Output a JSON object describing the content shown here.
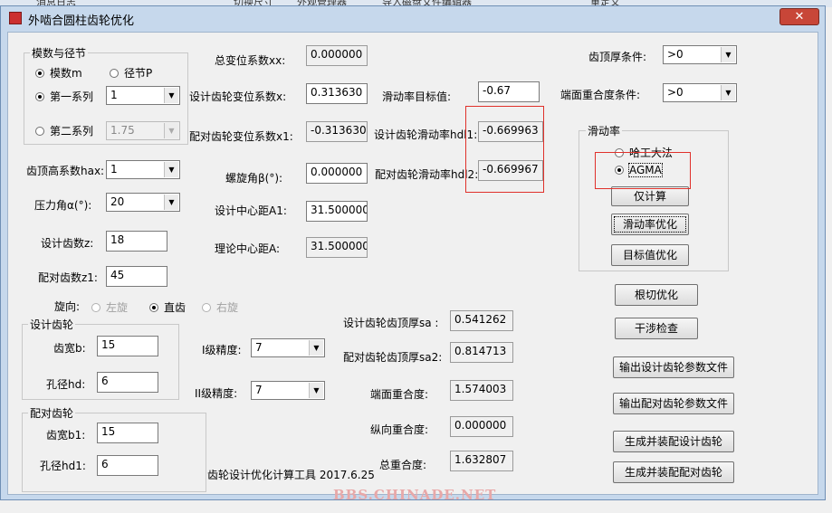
{
  "background_taskbar": [
    "消息日志",
    "切换尺寸",
    "外观管理器",
    "导入磁盘文件编辑器",
    "重定义"
  ],
  "window": {
    "title": "外啮合圆柱齿轮优化",
    "close_glyph": "✕"
  },
  "left_group": {
    "title": "模数与径节",
    "radio_modulus": "模数m",
    "radio_pitch": "径节P",
    "radio_series1": "第一系列",
    "series1_value": "1",
    "radio_series2": "第二系列",
    "series2_value": "1.75"
  },
  "fields": {
    "addendum_coef_label": "齿顶高系数hax:",
    "addendum_coef_value": "1",
    "pressure_angle_label": "压力角α(°):",
    "pressure_angle_value": "20",
    "teeth_z_label": "设计齿数z:",
    "teeth_z_value": "18",
    "teeth_z1_label": "配对齿数z1:",
    "teeth_z1_value": "45",
    "total_shift_label": "总变位系数xx:",
    "total_shift_value": "0.000000",
    "design_shift_label": "设计齿轮变位系数x:",
    "design_shift_value": "0.313630",
    "pair_shift_label": "配对齿轮变位系数x1:",
    "pair_shift_value": "-0.313630",
    "helix_angle_label": "螺旋角β(°):",
    "helix_angle_value": "0.000000",
    "design_center_label": "设计中心距A1:",
    "design_center_value": "31.500000",
    "theory_center_label": "理论中心距A:",
    "theory_center_value": "31.500000",
    "slide_target_label": "滑动率目标值:",
    "slide_target_value": "-0.67",
    "design_slide_label": "设计齿轮滑动率hdl1:",
    "design_slide_value": "-0.669963",
    "pair_slide_label": "配对齿轮滑动率hdl2:",
    "pair_slide_value": "-0.669967",
    "tip_thick_cond_label": "齿顶厚条件:",
    "tip_thick_cond_value": ">0",
    "contact_ratio_cond_label": "端面重合度条件:",
    "contact_ratio_cond_value": ">0"
  },
  "rotation": {
    "label": "旋向:",
    "left": "左旋",
    "straight": "直齿",
    "right": "右旋"
  },
  "design_gear": {
    "title": "设计齿轮",
    "width_label": "齿宽b:",
    "width_value": "15",
    "bore_label": "孔径hd:",
    "bore_value": "6"
  },
  "pair_gear": {
    "title": "配对齿轮",
    "width_label": "齿宽b1:",
    "width_value": "15",
    "bore_label": "孔径hd1:",
    "bore_value": "6"
  },
  "accuracy": {
    "grade1_label": "I级精度:",
    "grade1_value": "7",
    "grade2_label": "II级精度:",
    "grade2_value": "7"
  },
  "results": {
    "tip_thick_sa_label": "设计齿轮齿顶厚sa :",
    "tip_thick_sa_value": "0.541262",
    "tip_thick_sa2_label": "配对齿轮齿顶厚sa2:",
    "tip_thick_sa2_value": "0.814713",
    "transverse_label": "端面重合度:",
    "transverse_value": "1.574003",
    "axial_label": "纵向重合度:",
    "axial_value": "0.000000",
    "total_label": "总重合度:",
    "total_value": "1.632807"
  },
  "slide_group": {
    "title": "滑动率",
    "radio_hagong": "哈工大法",
    "radio_agma": "AGMA",
    "btn_calc": "仅计算",
    "btn_slide_opt": "滑动率优化",
    "btn_target_opt": "目标值优化"
  },
  "buttons": {
    "root_cut": "根切优化",
    "interference": "干涉检查",
    "export_design": "输出设计齿轮参数文件",
    "export_pair": "输出配对齿轮参数文件",
    "assemble_design": "生成并装配设计齿轮",
    "assemble_pair": "生成并装配配对齿轮"
  },
  "footer": "齿轮设计优化计算工具 2017.6.25",
  "watermark": "BBS.CHINADE.NET",
  "colors": {
    "highlight_red": "#e0312b",
    "window_frame": "#c6d8ec",
    "close_red": "#c84638"
  }
}
